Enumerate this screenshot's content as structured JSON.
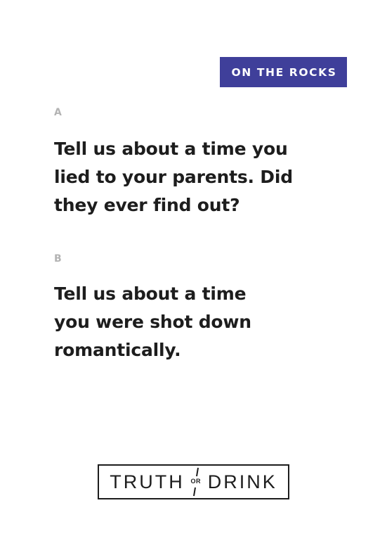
{
  "card": {
    "category": "ON THE ROCKS",
    "questions": [
      {
        "label": "A",
        "lines": [
          "Tell us about a time you",
          "lied to your parents. Did",
          "they ever find out?"
        ]
      },
      {
        "label": "B",
        "lines": [
          "Tell us about a time",
          "you were shot down",
          "romantically."
        ]
      }
    ]
  },
  "logo": {
    "left_word": "TRUTH",
    "middle": "OR",
    "right_word": "DRINK"
  },
  "colors": {
    "badge_background": "#3f3f9a",
    "text": "#1d1d1d",
    "label": "#b3b3b3"
  }
}
